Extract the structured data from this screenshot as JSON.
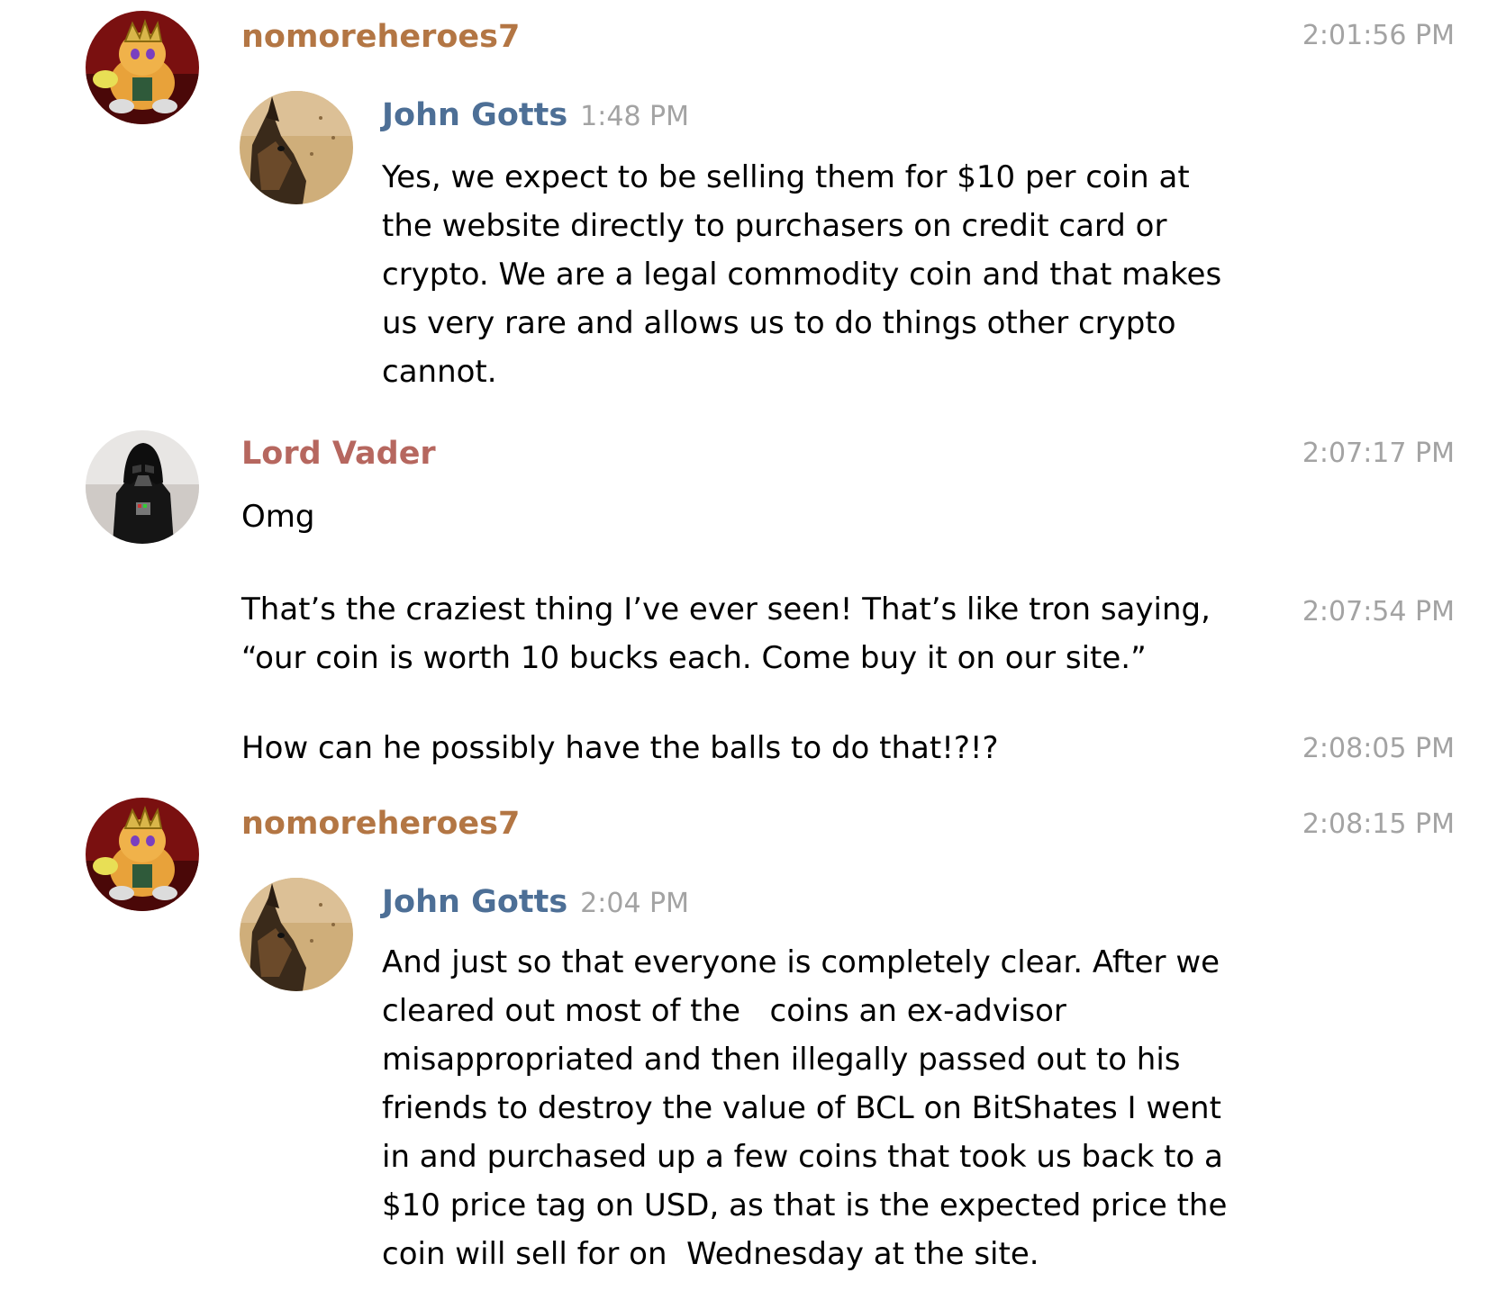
{
  "colors": {
    "nomoreheroes": "#b37644",
    "vader": "#b6675f",
    "john": "#4d6f96",
    "timestamp": "#a3a3a3"
  },
  "messages": [
    {
      "author": "nomoreheroes7",
      "avatar": "fox-king-avatar",
      "time": "2:01:56 PM",
      "forward": {
        "author": "John Gotts",
        "avatar": "german-shepherd-avatar",
        "time": "1:48 PM",
        "text": "Yes, we expect to be selling them for $10 per coin at\nthe website directly to purchasers on credit card or\ncrypto. We are a legal commodity coin and that makes\nus very rare and allows us to do things other crypto\ncannot."
      }
    },
    {
      "author": "Lord Vader",
      "avatar": "darth-vader-avatar",
      "time": "2:07:17 PM",
      "text": "Omg"
    },
    {
      "time": "2:07:54 PM",
      "text": "That’s the craziest thing I’ve ever seen! That’s like tron saying,\n“our coin is worth 10 bucks each. Come buy it on our site.”"
    },
    {
      "time": "2:08:05 PM",
      "text": "How can he possibly have the balls to do that!?!?"
    },
    {
      "author": "nomoreheroes7",
      "avatar": "fox-king-avatar",
      "time": "2:08:15 PM",
      "forward": {
        "author": "John Gotts",
        "avatar": "german-shepherd-avatar",
        "time": "2:04 PM",
        "text": "And just so that everyone is completely clear. After we\ncleared out most of the   coins an ex-advisor\nmisappropriated and then illegally passed out to his\nfriends to destroy the value of BCL on BitShates I went\nin and purchased up a few coins that took us back to a\n$10 price tag on USD, as that is the expected price the\ncoin will sell for on  Wednesday at the site."
      }
    }
  ]
}
